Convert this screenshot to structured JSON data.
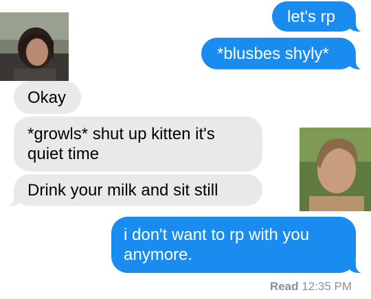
{
  "messages": [
    {
      "sender": "me",
      "text": "let's rp"
    },
    {
      "sender": "me",
      "text": "*blusbes shyly*"
    },
    {
      "sender": "them",
      "text": "Okay"
    },
    {
      "sender": "them",
      "text": "*growls* shut up kitten it's quiet time"
    },
    {
      "sender": "them",
      "text": "Drink your milk and sit still"
    },
    {
      "sender": "me",
      "text": "i don't want to rp with you anymore."
    }
  ],
  "receipt": {
    "label": "Read",
    "time": "12:35 PM"
  },
  "colors": {
    "outgoing": "#1a8cf0",
    "incoming": "#e9e9eb",
    "meta": "#8e8e93"
  }
}
